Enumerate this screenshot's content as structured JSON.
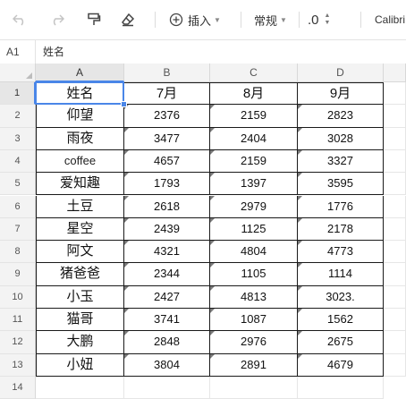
{
  "toolbar": {
    "insert_label": "插入",
    "format_label": "常规",
    "decimal_label": ".0",
    "font_label": "Calibri"
  },
  "formula_bar": {
    "cell_ref": "A1",
    "content": "姓名"
  },
  "columns": [
    "A",
    "B",
    "C",
    "D"
  ],
  "rows": [
    "1",
    "2",
    "3",
    "4",
    "5",
    "6",
    "7",
    "8",
    "9",
    "10",
    "11",
    "12",
    "13",
    "14"
  ],
  "table": {
    "headers": [
      "姓名",
      "7月",
      "8月",
      "9月"
    ],
    "data": [
      [
        "仰望",
        "2376",
        "2159",
        "2823"
      ],
      [
        "雨夜",
        "3477",
        "2404",
        "3028"
      ],
      [
        "coffee",
        "4657",
        "2159",
        "3327"
      ],
      [
        "爱知趣",
        "1793",
        "1397",
        "3595"
      ],
      [
        "土豆",
        "2618",
        "2979",
        "1776"
      ],
      [
        "星空",
        "2439",
        "1125",
        "2178"
      ],
      [
        "阿文",
        "4321",
        "4804",
        "4773"
      ],
      [
        "猪爸爸",
        "2344",
        "1105",
        "1114"
      ],
      [
        "小玉",
        "2427",
        "4813",
        "3023."
      ],
      [
        "猫哥",
        "3741",
        "1087",
        "1562"
      ],
      [
        "大鹏",
        "2848",
        "2976",
        "2675"
      ],
      [
        "小妞",
        "3804",
        "2891",
        "4679"
      ]
    ]
  },
  "colors": {
    "selection": "#4a86e8",
    "border": "#1a1a1a",
    "header_bg": "#f3f3f3"
  }
}
